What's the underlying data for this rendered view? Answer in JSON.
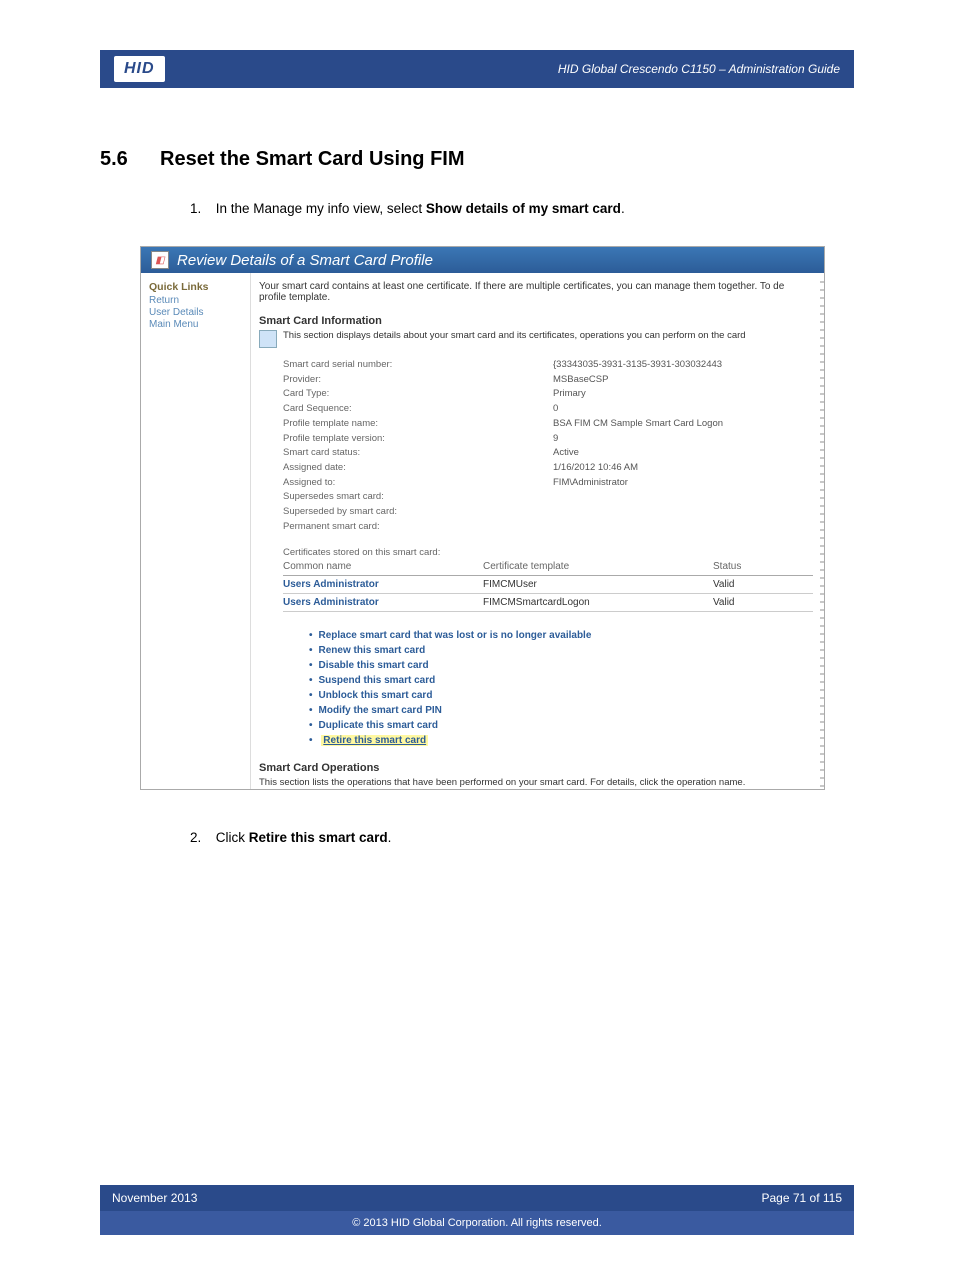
{
  "header": {
    "logo_text": "HID",
    "doc_title": "HID Global Crescendo C1150  – Administration Guide"
  },
  "section": {
    "number": "5.6",
    "title": "Reset the Smart Card Using FIM"
  },
  "steps": {
    "s1_num": "1.",
    "s1_a": "In the Manage my info view, select ",
    "s1_b": "Show details of my smart card",
    "s1_c": ".",
    "s2_num": "2.",
    "s2_a": "Click ",
    "s2_b": "Retire this smart card",
    "s2_c": "."
  },
  "sshot": {
    "title": "Review Details of a Smart Card Profile",
    "sidebar": {
      "heading": "Quick Links",
      "items": [
        "Return",
        "User Details",
        "Main Menu"
      ]
    },
    "intro": "Your smart card contains at least one certificate. If there are multiple certificates, you can manage them together. To de",
    "intro2": "profile template.",
    "info_heading": "Smart Card Information",
    "info_sub": "This section displays details about your smart card and its certificates, operations you can perform on the card",
    "kv": [
      {
        "label": "Smart card serial number:",
        "value": "{33343035-3931-3135-3931-303032443"
      },
      {
        "label": "Provider:",
        "value": "MSBaseCSP"
      },
      {
        "label": "Card Type:",
        "value": "Primary"
      },
      {
        "label": "Card Sequence:",
        "value": "0"
      },
      {
        "label": "Profile template name:",
        "value": "BSA FIM CM Sample Smart Card Logon"
      },
      {
        "label": "Profile template version:",
        "value": "9"
      },
      {
        "label": "Smart card status:",
        "value": "Active"
      },
      {
        "label": "Assigned date:",
        "value": "1/16/2012 10:46 AM"
      },
      {
        "label": "Assigned to:",
        "value": "FIM\\Administrator"
      },
      {
        "label": "Supersedes smart card:",
        "value": ""
      },
      {
        "label": "Superseded by smart card:",
        "value": ""
      },
      {
        "label": "Permanent smart card:",
        "value": ""
      }
    ],
    "certs_header": "Certificates stored on this smart card:",
    "certs_cols": {
      "c1": "Common name",
      "c2": "Certificate template",
      "c3": "Status"
    },
    "certs": [
      {
        "cn": "Users Administrator",
        "tpl": "FIMCMUser",
        "status": "Valid"
      },
      {
        "cn": "Users Administrator",
        "tpl": "FIMCMSmartcardLogon",
        "status": "Valid"
      }
    ],
    "actions": [
      "Replace smart card that was lost or is no longer available",
      "Renew this smart card",
      "Disable this smart card",
      "Suspend this smart card",
      "Unblock this smart card",
      "Modify the smart card PIN",
      "Duplicate this smart card",
      "Retire this smart card"
    ],
    "ops_heading": "Smart Card Operations",
    "ops_sub": "This section lists the operations that have been performed on your smart card. For details, click the operation name."
  },
  "footer": {
    "date": "November 2013",
    "page": "Page 71 of 115",
    "copyright": "© 2013 HID Global Corporation. All rights reserved."
  }
}
